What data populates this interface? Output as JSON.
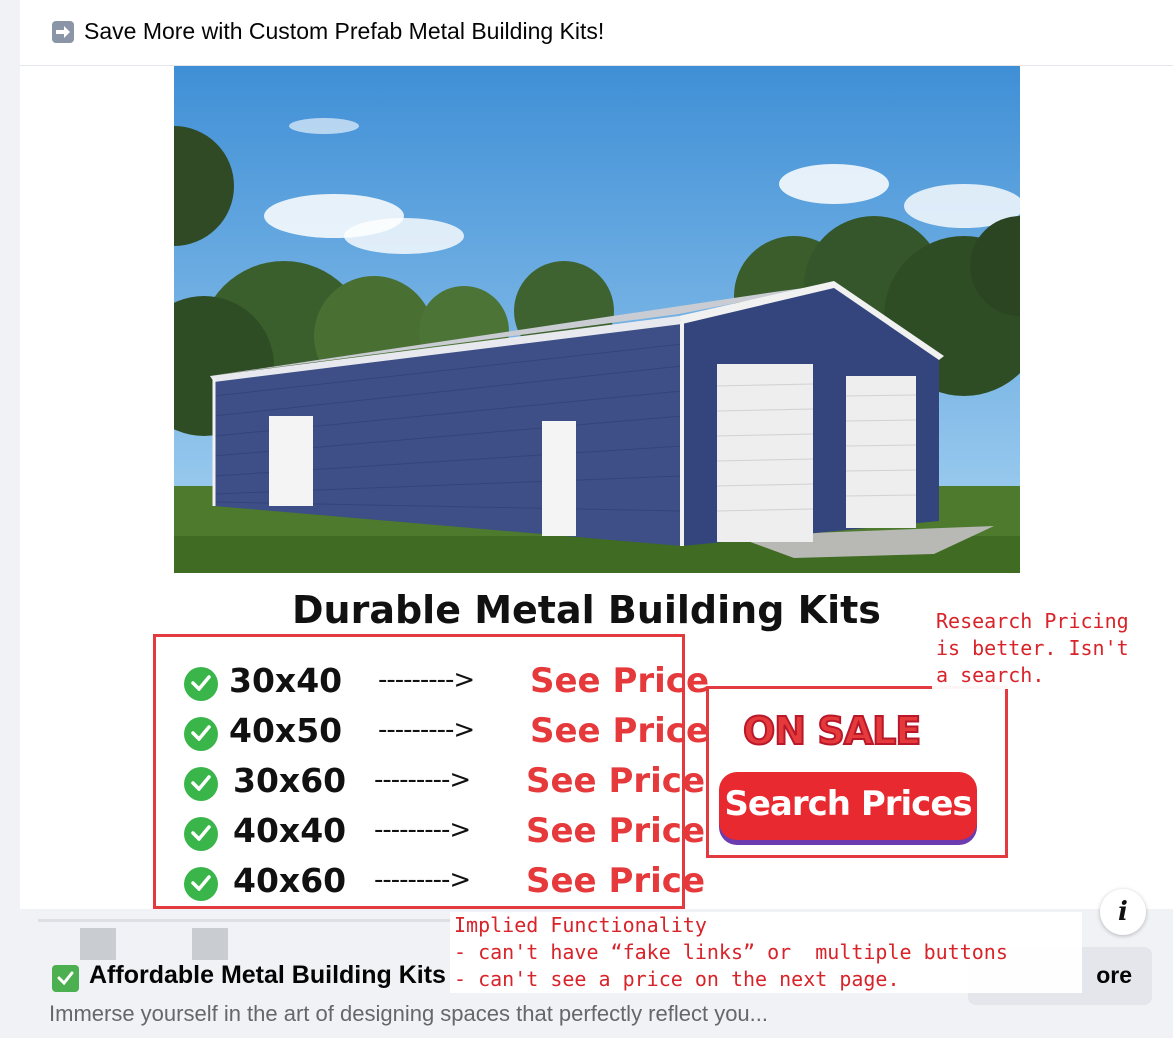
{
  "post": {
    "text": "Save More with Custom Prefab Metal Building Kits!",
    "emoji_icon": "right-arrow-emoji"
  },
  "creative": {
    "headline": "Durable Metal Building Kits",
    "sizes": [
      {
        "size": "30x40",
        "dashes": "--------->",
        "price_label": "See Price"
      },
      {
        "size": "40x50",
        "dashes": "--------->",
        "price_label": "See Price"
      },
      {
        "size": "30x60",
        "dashes": "--------->",
        "price_label": "See Price"
      },
      {
        "size": "40x40",
        "dashes": "--------->",
        "price_label": "See Price"
      },
      {
        "size": "40x60",
        "dashes": "--------->",
        "price_label": "See Price"
      }
    ],
    "on_sale": "ON SALE",
    "search_button": "Search Prices",
    "accent_color": "#e5393b"
  },
  "annotations": {
    "note_1": "Research Pricing\nis better. Isn't\na search.",
    "note_2": "Implied Functionality\n- can't have “fake links” or  multiple buttons\n- can't see a price on the next page."
  },
  "info_button": "i",
  "link_preview": {
    "title": "Affordable Metal Building Kits",
    "description": "Immerse yourself in the art of designing spaces that perfectly reflect you...",
    "cta": "Learn more",
    "cta_visible": "ore"
  }
}
